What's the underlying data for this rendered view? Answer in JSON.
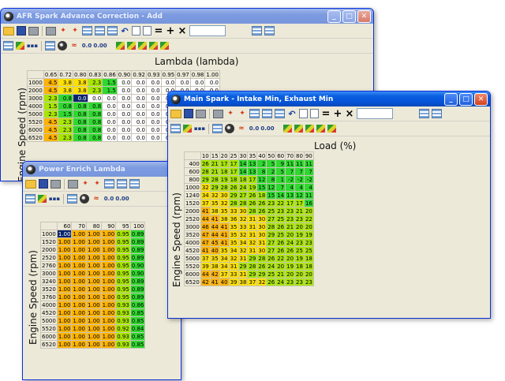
{
  "colors": {
    "red": "#f42400",
    "orange": "#ffb300",
    "yellow": "#ffe100",
    "lime": "#a8e600",
    "green": "#2fd82f",
    "white": "#ffffff",
    "selection": "#0a246a"
  },
  "windows": {
    "afr": {
      "title": "AFR Spark Advance Correction - Add",
      "x_axis_label": "Lambda (lambda)",
      "y_axis_label": "Engine Speed (rpm)",
      "columns": [
        "0.65",
        "0.72",
        "0.80",
        "0.83",
        "0.86",
        "0.90",
        "0.92",
        "0.93",
        "0.95",
        "0.97",
        "0.98",
        "1.00"
      ],
      "rows": [
        {
          "rpm": "1000",
          "values": [
            "4.5",
            "3.8",
            "3.8",
            "2.3",
            "1.5",
            "0.0",
            "0.0",
            "0.0",
            "0.0",
            "0.0",
            "0.0",
            "0.0"
          ],
          "colors": [
            "orange",
            "yellow",
            "yellow",
            "lime",
            "green",
            "white",
            "white",
            "white",
            "white",
            "white",
            "white",
            "white"
          ]
        },
        {
          "rpm": "2000",
          "values": [
            "4.5",
            "3.8",
            "3.8",
            "2.3",
            "1.5",
            "0.0",
            "0.0",
            "0.0",
            "0.0",
            "0.0",
            "0.0",
            "0.0"
          ],
          "colors": [
            "orange",
            "yellow",
            "yellow",
            "lime",
            "green",
            "white",
            "white",
            "white",
            "white",
            "white",
            "white",
            "white"
          ]
        },
        {
          "rpm": "3000",
          "values": [
            "2.3",
            "0.8",
            "0.0",
            "0.0",
            "0.0",
            "0.0",
            "0.0",
            "0.0",
            "0.0",
            "0.0",
            "0.0",
            "0.0"
          ],
          "colors": [
            "lime",
            "green",
            "selection",
            "white",
            "white",
            "white",
            "white",
            "white",
            "white",
            "white",
            "white",
            "white"
          ]
        },
        {
          "rpm": "4000",
          "values": [
            "1.5",
            "0.8",
            "0.8",
            "0.8",
            "0.0",
            "0.0",
            "0.0",
            "0.0",
            "0.0",
            "0.0",
            "0.0",
            "0.0"
          ],
          "colors": [
            "lime",
            "green",
            "green",
            "green",
            "white",
            "white",
            "white",
            "white",
            "white",
            "white",
            "white",
            "white"
          ]
        },
        {
          "rpm": "5000",
          "values": [
            "2.3",
            "1.5",
            "0.8",
            "0.8",
            "0.0",
            "0.0",
            "0.0",
            "0.0",
            "0.0",
            "0.0",
            "0.0",
            "0.0"
          ],
          "colors": [
            "lime",
            "green",
            "green",
            "green",
            "white",
            "white",
            "white",
            "white",
            "white",
            "white",
            "white",
            "white"
          ]
        },
        {
          "rpm": "5520",
          "values": [
            "4.5",
            "2.3",
            "0.8",
            "0.8",
            "0.0",
            "0.0",
            "0.0",
            "0.0",
            "0.0",
            "0.0",
            "0.0",
            "0.0"
          ],
          "colors": [
            "orange",
            "lime",
            "green",
            "green",
            "white",
            "white",
            "white",
            "white",
            "white",
            "white",
            "white",
            "white"
          ]
        },
        {
          "rpm": "6000",
          "values": [
            "4.5",
            "2.3",
            "0.8",
            "0.8",
            "0.0",
            "0.0",
            "0.0",
            "0.0",
            "0.0",
            "0.0",
            "0.0",
            "0.0"
          ],
          "colors": [
            "orange",
            "lime",
            "green",
            "green",
            "white",
            "white",
            "white",
            "white",
            "white",
            "white",
            "white",
            "white"
          ]
        },
        {
          "rpm": "6520",
          "values": [
            "4.5",
            "2.3",
            "0.8",
            "0.8",
            "0.0",
            "0.0",
            "0.0",
            "0.0",
            "0.0",
            "0.0",
            "0.0",
            "0.0"
          ],
          "colors": [
            "orange",
            "lime",
            "green",
            "green",
            "white",
            "white",
            "white",
            "white",
            "white",
            "white",
            "white",
            "white"
          ]
        }
      ]
    },
    "enrich": {
      "title": "Power Enrich Lambda",
      "y_axis_label": "Engine Speed (rpm)",
      "columns": [
        "60",
        "70",
        "80",
        "90",
        "95",
        "100"
      ],
      "rows": [
        {
          "rpm": "1000",
          "values": [
            "1.00",
            "1.00",
            "1.00",
            "1.00",
            "0.95",
            "0.89"
          ]
        },
        {
          "rpm": "1520",
          "values": [
            "1.00",
            "1.00",
            "1.00",
            "1.00",
            "0.95",
            "0.89"
          ]
        },
        {
          "rpm": "2000",
          "values": [
            "1.00",
            "1.00",
            "1.00",
            "1.00",
            "0.95",
            "0.89"
          ]
        },
        {
          "rpm": "2520",
          "values": [
            "1.00",
            "1.00",
            "1.00",
            "1.00",
            "0.95",
            "0.89"
          ]
        },
        {
          "rpm": "2760",
          "values": [
            "1.00",
            "1.00",
            "1.00",
            "1.00",
            "0.95",
            "0.90"
          ]
        },
        {
          "rpm": "3000",
          "values": [
            "1.00",
            "1.00",
            "1.00",
            "1.00",
            "0.95",
            "0.90"
          ]
        },
        {
          "rpm": "3240",
          "values": [
            "1.00",
            "1.00",
            "1.00",
            "1.00",
            "0.95",
            "0.89"
          ]
        },
        {
          "rpm": "3520",
          "values": [
            "1.00",
            "1.00",
            "1.00",
            "1.00",
            "0.95",
            "0.89"
          ]
        },
        {
          "rpm": "3760",
          "values": [
            "1.00",
            "1.00",
            "1.00",
            "1.00",
            "0.95",
            "0.89"
          ]
        },
        {
          "rpm": "4000",
          "values": [
            "1.00",
            "1.00",
            "1.00",
            "1.00",
            "0.93",
            "0.86"
          ]
        },
        {
          "rpm": "4520",
          "values": [
            "1.00",
            "1.00",
            "1.00",
            "1.00",
            "0.93",
            "0.85"
          ]
        },
        {
          "rpm": "5000",
          "values": [
            "1.00",
            "1.00",
            "1.00",
            "1.00",
            "0.93",
            "0.85"
          ]
        },
        {
          "rpm": "5520",
          "values": [
            "1.00",
            "1.00",
            "1.00",
            "1.00",
            "0.92",
            "0.84"
          ]
        },
        {
          "rpm": "6000",
          "values": [
            "1.00",
            "1.00",
            "1.00",
            "1.00",
            "0.93",
            "0.85"
          ]
        },
        {
          "rpm": "6520",
          "values": [
            "1.00",
            "1.00",
            "1.00",
            "1.00",
            "0.93",
            "0.85"
          ]
        }
      ]
    },
    "main": {
      "title": "Main Spark - Intake Min, Exhaust Min",
      "x_axis_label": "Load (%)",
      "y_axis_label": "Engine Speed (rpm)",
      "columns": [
        "10",
        "15",
        "20",
        "25",
        "30",
        "35",
        "40",
        "50",
        "60",
        "70",
        "80",
        "90"
      ],
      "rows": [
        {
          "rpm": "400",
          "values": [
            "26",
            "21",
            "17",
            "17",
            "14",
            "13",
            "2",
            "5",
            "9",
            "11",
            "11",
            "11"
          ]
        },
        {
          "rpm": "600",
          "values": [
            "28",
            "21",
            "18",
            "17",
            "14",
            "13",
            "8",
            "2",
            "5",
            "7",
            "7",
            "7"
          ]
        },
        {
          "rpm": "800",
          "values": [
            "29",
            "28",
            "19",
            "18",
            "18",
            "17",
            "12",
            "8",
            "1",
            "-2",
            "-2",
            "-2"
          ]
        },
        {
          "rpm": "1000",
          "values": [
            "32",
            "29",
            "28",
            "26",
            "24",
            "19",
            "15",
            "12",
            "7",
            "4",
            "4",
            "4"
          ]
        },
        {
          "rpm": "1240",
          "values": [
            "34",
            "32",
            "30",
            "29",
            "27",
            "26",
            "18",
            "15",
            "14",
            "13",
            "12",
            "11"
          ]
        },
        {
          "rpm": "1520",
          "values": [
            "37",
            "35",
            "32",
            "28",
            "28",
            "26",
            "26",
            "23",
            "22",
            "17",
            "17",
            "16"
          ]
        },
        {
          "rpm": "2000",
          "values": [
            "41",
            "38",
            "35",
            "33",
            "30",
            "28",
            "26",
            "25",
            "23",
            "23",
            "21",
            "20"
          ]
        },
        {
          "rpm": "2520",
          "values": [
            "44",
            "41",
            "38",
            "36",
            "32",
            "31",
            "30",
            "27",
            "25",
            "23",
            "23",
            "22"
          ]
        },
        {
          "rpm": "3000",
          "values": [
            "46",
            "44",
            "41",
            "35",
            "33",
            "31",
            "30",
            "28",
            "26",
            "21",
            "20",
            "20"
          ]
        },
        {
          "rpm": "3520",
          "values": [
            "47",
            "44",
            "41",
            "35",
            "32",
            "31",
            "30",
            "29",
            "25",
            "20",
            "19",
            "19"
          ]
        },
        {
          "rpm": "4000",
          "values": [
            "47",
            "45",
            "41",
            "35",
            "34",
            "32",
            "31",
            "27",
            "26",
            "24",
            "23",
            "23"
          ]
        },
        {
          "rpm": "4520",
          "values": [
            "41",
            "40",
            "35",
            "34",
            "32",
            "31",
            "30",
            "27",
            "26",
            "26",
            "25",
            "25"
          ]
        },
        {
          "rpm": "5000",
          "values": [
            "37",
            "35",
            "34",
            "32",
            "31",
            "29",
            "28",
            "26",
            "22",
            "20",
            "19",
            "18"
          ]
        },
        {
          "rpm": "5520",
          "values": [
            "39",
            "38",
            "34",
            "31",
            "29",
            "28",
            "26",
            "24",
            "20",
            "19",
            "18",
            "18"
          ]
        },
        {
          "rpm": "6000",
          "values": [
            "44",
            "42",
            "37",
            "33",
            "31",
            "29",
            "29",
            "25",
            "21",
            "20",
            "20",
            "20"
          ]
        },
        {
          "rpm": "6520",
          "values": [
            "42",
            "41",
            "40",
            "39",
            "38",
            "37",
            "32",
            "26",
            "24",
            "23",
            "23",
            "23"
          ]
        }
      ]
    }
  }
}
